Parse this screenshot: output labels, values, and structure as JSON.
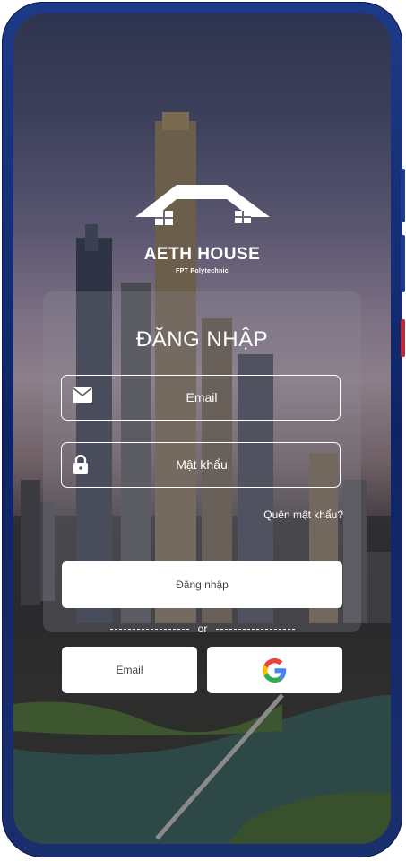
{
  "app": {
    "brand": "AETH HOUSE",
    "brand_sub": "FPT Polytechnic"
  },
  "login": {
    "title": "ĐĂNG NHẬP",
    "email_placeholder": "Email",
    "password_placeholder": "Mật khẩu",
    "forgot_link": "Quên mật khẩu?",
    "login_button": "Đăng nhập",
    "divider": "or",
    "email_button": "Email"
  },
  "colors": {
    "card": "rgba(140,140,150,0.28)",
    "button_bg": "#ffffff",
    "text_light": "#ffffff",
    "text_dark": "#444444"
  },
  "icons": [
    "mail-icon",
    "lock-icon",
    "google-logo-icon",
    "house-logo-icon"
  ]
}
